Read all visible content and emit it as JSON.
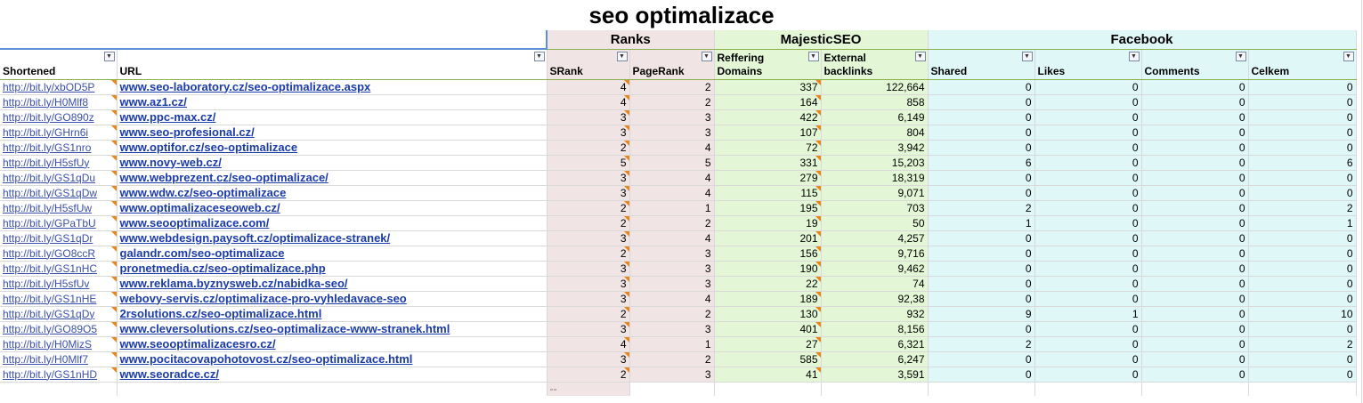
{
  "title": "seo optimalizace",
  "groups": {
    "ranks": "Ranks",
    "majestic": "MajesticSEO",
    "facebook": "Facebook"
  },
  "headers": {
    "shortened": "Shortened",
    "url": "URL",
    "srank": "SRank",
    "pagerank": "PageRank",
    "reffering_domains": [
      "Reffering",
      "Domains"
    ],
    "external_backlinks": [
      "External",
      "backlinks"
    ],
    "shared": "Shared",
    "likes": "Likes",
    "comments": "Comments",
    "celkem": "Celkem"
  },
  "filter_icon": "dropdown-arrow-icon",
  "colors": {
    "ranks_bg": "#f1e4e4",
    "majestic_bg": "#e3f7d6",
    "facebook_bg": "#dff7f7",
    "link": "#1a3ba8",
    "comment_flag": "#e8861a"
  },
  "rows": [
    {
      "short": "http://bit.ly/xbOD5P",
      "url": "www.seo-laboratory.cz/seo-optimalizace.aspx",
      "srank": "4",
      "pagerank": "2",
      "domains": "337",
      "backlinks": "122,664",
      "shared": "0",
      "likes": "0",
      "comments": "0",
      "celkem": "0"
    },
    {
      "short": "http://bit.ly/H0Mlf8",
      "url": "www.az1.cz/",
      "srank": "4",
      "pagerank": "2",
      "domains": "164",
      "backlinks": "858",
      "shared": "0",
      "likes": "0",
      "comments": "0",
      "celkem": "0"
    },
    {
      "short": "http://bit.ly/GO890z",
      "url": "www.ppc-max.cz/",
      "srank": "3",
      "pagerank": "3",
      "domains": "422",
      "backlinks": "6,149",
      "shared": "0",
      "likes": "0",
      "comments": "0",
      "celkem": "0"
    },
    {
      "short": "http://bit.ly/GHrn6i",
      "url": "www.seo-profesional.cz/",
      "srank": "3",
      "pagerank": "3",
      "domains": "107",
      "backlinks": "804",
      "shared": "0",
      "likes": "0",
      "comments": "0",
      "celkem": "0"
    },
    {
      "short": "http://bit.ly/GS1nro",
      "url": "www.optifor.cz/seo-optimalizace",
      "srank": "2",
      "pagerank": "4",
      "domains": "72",
      "backlinks": "3,942",
      "shared": "0",
      "likes": "0",
      "comments": "0",
      "celkem": "0"
    },
    {
      "short": "http://bit.ly/H5sfUy",
      "url": "www.novy-web.cz/",
      "srank": "5",
      "pagerank": "5",
      "domains": "331",
      "backlinks": "15,203",
      "shared": "6",
      "likes": "0",
      "comments": "0",
      "celkem": "6"
    },
    {
      "short": "http://bit.ly/GS1qDu",
      "url": "www.webprezent.cz/seo-optimalizace/",
      "srank": "3",
      "pagerank": "4",
      "domains": "279",
      "backlinks": "18,319",
      "shared": "0",
      "likes": "0",
      "comments": "0",
      "celkem": "0"
    },
    {
      "short": "http://bit.ly/GS1qDw",
      "url": "www.wdw.cz/seo-optimalizace",
      "srank": "3",
      "pagerank": "4",
      "domains": "115",
      "backlinks": "9,071",
      "shared": "0",
      "likes": "0",
      "comments": "0",
      "celkem": "0"
    },
    {
      "short": "http://bit.ly/H5sfUw",
      "url": "www.optimalizaceseoweb.cz/",
      "srank": "2",
      "pagerank": "1",
      "domains": "195",
      "backlinks": "703",
      "shared": "2",
      "likes": "0",
      "comments": "0",
      "celkem": "2"
    },
    {
      "short": "http://bit.ly/GPaTbU",
      "url": "www.seooptimalizace.com/",
      "srank": "2",
      "pagerank": "2",
      "domains": "19",
      "backlinks": "50",
      "shared": "1",
      "likes": "0",
      "comments": "0",
      "celkem": "1"
    },
    {
      "short": "http://bit.ly/GS1qDr",
      "url": "www.webdesign.paysoft.cz/optimalizace-stranek/",
      "srank": "3",
      "pagerank": "4",
      "domains": "201",
      "backlinks": "4,257",
      "shared": "0",
      "likes": "0",
      "comments": "0",
      "celkem": "0"
    },
    {
      "short": "http://bit.ly/GO8ccR",
      "url": "galandr.com/seo-optimalizace",
      "srank": "2",
      "pagerank": "3",
      "domains": "156",
      "backlinks": "9,716",
      "shared": "0",
      "likes": "0",
      "comments": "0",
      "celkem": "0"
    },
    {
      "short": "http://bit.ly/GS1nHC",
      "url": "pronetmedia.cz/seo-optimalizace.php",
      "srank": "3",
      "pagerank": "3",
      "domains": "190",
      "backlinks": "9,462",
      "shared": "0",
      "likes": "0",
      "comments": "0",
      "celkem": "0"
    },
    {
      "short": "http://bit.ly/H5sfUv",
      "url": "www.reklama.byznysweb.cz/nabidka-seo/",
      "srank": "3",
      "pagerank": "3",
      "domains": "22",
      "backlinks": "74",
      "shared": "0",
      "likes": "0",
      "comments": "0",
      "celkem": "0"
    },
    {
      "short": "http://bit.ly/GS1nHE",
      "url": "webovy-servis.cz/optimalizace-pro-vyhledavace-seo",
      "srank": "3",
      "pagerank": "4",
      "domains": "189",
      "backlinks": "92,38",
      "shared": "0",
      "likes": "0",
      "comments": "0",
      "celkem": "0"
    },
    {
      "short": "http://bit.ly/GS1qDy",
      "url": "2rsolutions.cz/seo-optimalizace.html",
      "srank": "2",
      "pagerank": "2",
      "domains": "130",
      "backlinks": "932",
      "shared": "9",
      "likes": "1",
      "comments": "0",
      "celkem": "10"
    },
    {
      "short": "http://bit.ly/GO89O5",
      "url": "www.cleversolutions.cz/seo-optimalizace-www-stranek.html",
      "srank": "3",
      "pagerank": "3",
      "domains": "401",
      "backlinks": "8,156",
      "shared": "0",
      "likes": "0",
      "comments": "0",
      "celkem": "0"
    },
    {
      "short": "http://bit.ly/H0MizS",
      "url": "www.seooptimalizacesro.cz/",
      "srank": "4",
      "pagerank": "1",
      "domains": "27",
      "backlinks": "6,321",
      "shared": "2",
      "likes": "0",
      "comments": "0",
      "celkem": "2"
    },
    {
      "short": "http://bit.ly/H0Mlf7",
      "url": "www.pocitacovapohotovost.cz/seo-optimalizace.html",
      "srank": "3",
      "pagerank": "2",
      "domains": "585",
      "backlinks": "6,247",
      "shared": "0",
      "likes": "0",
      "comments": "0",
      "celkem": "0"
    },
    {
      "short": "http://bit.ly/GS1nHD",
      "url": "www.seoradce.cz/",
      "srank": "2",
      "pagerank": "3",
      "domains": "41",
      "backlinks": "3,591",
      "shared": "0",
      "likes": "0",
      "comments": "0",
      "celkem": "0"
    }
  ],
  "tail_marker": "--"
}
